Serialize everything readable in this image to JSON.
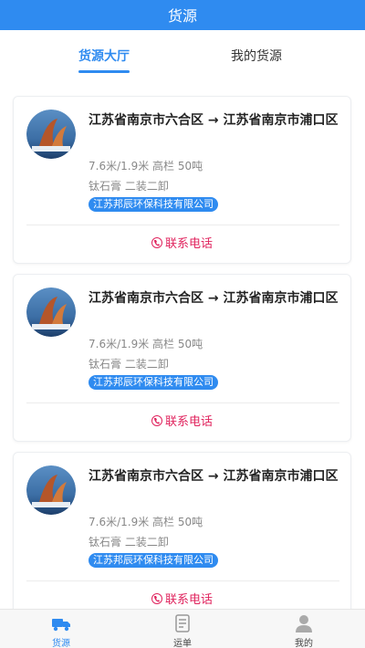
{
  "header": {
    "title": "货源"
  },
  "tabs": [
    {
      "label": "货源大厅",
      "active": true
    },
    {
      "label": "我的货源",
      "active": false
    }
  ],
  "cards": [
    {
      "route": "江苏省南京市六合区 → 江苏省南京市浦口区",
      "spec": "7.6米/1.9米 高栏 50吨",
      "cargo": "钛石膏 二装二卸",
      "company": "江苏邦辰环保科技有限公司",
      "contact_label": "联系电话"
    },
    {
      "route": "江苏省南京市六合区 → 江苏省南京市浦口区",
      "spec": "7.6米/1.9米 高栏 50吨",
      "cargo": "钛石膏 二装二卸",
      "company": "江苏邦辰环保科技有限公司",
      "contact_label": "联系电话"
    },
    {
      "route": "江苏省南京市六合区 → 江苏省南京市浦口区",
      "spec": "7.6米/1.9米 高栏 50吨",
      "cargo": "钛石膏 二装二卸",
      "company": "江苏邦辰环保科技有限公司",
      "contact_label": "联系电话"
    }
  ],
  "bottom_nav": [
    {
      "label": "货源",
      "icon": "truck-icon",
      "active": true
    },
    {
      "label": "运单",
      "icon": "waybill-icon",
      "active": false
    },
    {
      "label": "我的",
      "icon": "user-icon",
      "active": false
    }
  ],
  "colors": {
    "primary": "#2f8bf0",
    "contact": "#e0245e"
  }
}
